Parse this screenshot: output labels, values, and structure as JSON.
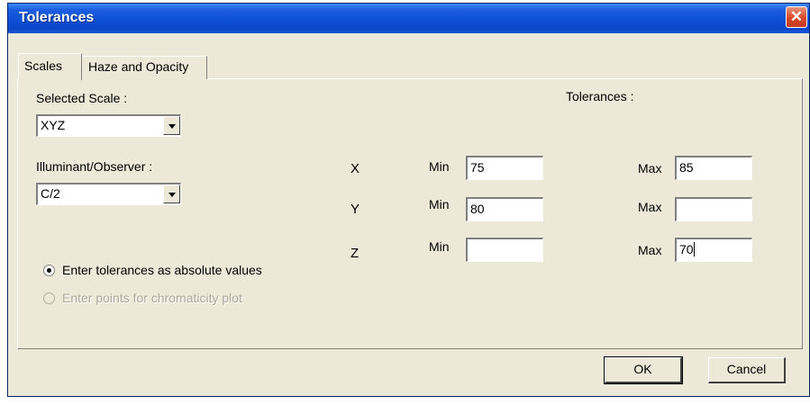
{
  "window": {
    "title": "Tolerances"
  },
  "tabs": [
    {
      "label": "Scales",
      "active": true
    },
    {
      "label": "Haze and Opacity",
      "active": false
    }
  ],
  "scale": {
    "label": "Selected Scale :",
    "value": "XYZ"
  },
  "illuminant": {
    "label": "Illuminant/Observer :",
    "value": "C/2"
  },
  "tolerances_header": "Tolerances :",
  "min_label": "Min",
  "max_label": "Max",
  "rows": [
    {
      "name": "X",
      "min": "75",
      "max": "85"
    },
    {
      "name": "Y",
      "min": "80",
      "max": ""
    },
    {
      "name": "Z",
      "min": "",
      "max": "70"
    }
  ],
  "options": [
    {
      "label": "Enter tolerances as absolute values",
      "checked": true,
      "enabled": true
    },
    {
      "label": "Enter points for chromaticity plot",
      "checked": false,
      "enabled": false
    }
  ],
  "buttons": {
    "ok": "OK",
    "cancel": "Cancel"
  },
  "colors": {
    "titlebar": "#0A46C9",
    "dialog_bg": "#ECE9D8",
    "close": "#D9472A"
  },
  "icons": {
    "close": "close-icon"
  }
}
